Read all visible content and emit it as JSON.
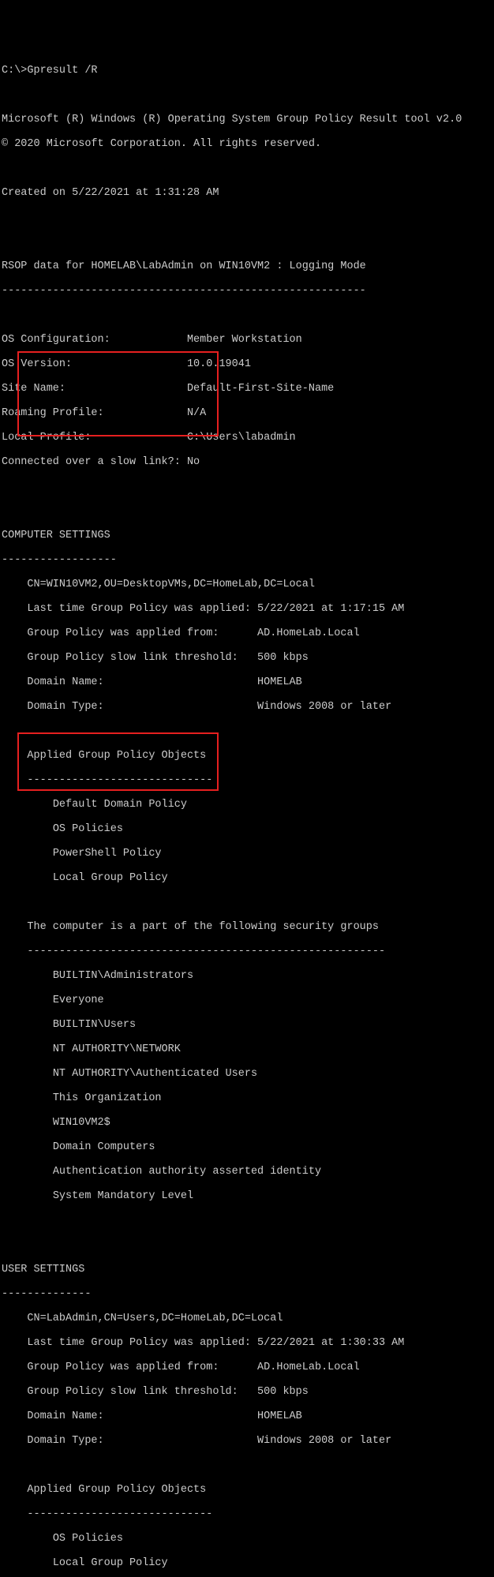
{
  "prompt": "C:\\>Gpresult /R",
  "header": [
    "Microsoft (R) Windows (R) Operating System Group Policy Result tool v2.0",
    "© 2020 Microsoft Corporation. All rights reserved."
  ],
  "created": "Created on ‎5/‎22/‎2021 at 1:31:28 AM",
  "rsop_line": "RSOP data for HOMELAB\\LabAdmin on WIN10VM2 : Logging Mode",
  "rsop_rule": "---------------------------------------------------------",
  "sysinfo": [
    "OS Configuration:            Member Workstation",
    "OS Version:                  10.0.19041",
    "Site Name:                   Default-First-Site-Name",
    "Roaming Profile:             N/A",
    "Local Profile:               C:\\Users\\labadmin",
    "Connected over a slow link?: No"
  ],
  "computer_settings_header": "COMPUTER SETTINGS",
  "computer_settings_rule": "------------------",
  "comp_meta": [
    "CN=WIN10VM2,OU=DesktopVMs,DC=HomeLab,DC=Local",
    "Last time Group Policy was applied: 5/22/2021 at 1:17:15 AM",
    "Group Policy was applied from:      AD.HomeLab.Local",
    "Group Policy slow link threshold:   500 kbps",
    "Domain Name:                        HOMELAB",
    "Domain Type:                        Windows 2008 or later"
  ],
  "applied_gpo_header": "Applied Group Policy Objects",
  "applied_gpo_rule": "-----------------------------",
  "comp_gpos": [
    "Default Domain Policy",
    "OS Policies",
    "PowerShell Policy",
    "Local Group Policy"
  ],
  "sec_groups_header": "The computer is a part of the following security groups",
  "sec_groups_rule": "--------------------------------------------------------",
  "sec_groups": [
    "BUILTIN\\Administrators",
    "Everyone",
    "BUILTIN\\Users",
    "NT AUTHORITY\\NETWORK",
    "NT AUTHORITY\\Authenticated Users",
    "This Organization",
    "WIN10VM2$",
    "Domain Computers",
    "Authentication authority asserted identity",
    "System Mandatory Level"
  ],
  "user_settings_header": "USER SETTINGS",
  "user_settings_rule": "--------------",
  "user_meta": [
    "CN=LabAdmin,CN=Users,DC=HomeLab,DC=Local",
    "Last time Group Policy was applied: 5/22/2021 at 1:30:33 AM",
    "Group Policy was applied from:      AD.HomeLab.Local",
    "Group Policy slow link threshold:   500 kbps",
    "Domain Name:                        HOMELAB",
    "Domain Type:                        Windows 2008 or later"
  ],
  "user_gpos": [
    "OS Policies",
    "Local Group Policy"
  ],
  "indent4": "    ",
  "indent8": "        "
}
